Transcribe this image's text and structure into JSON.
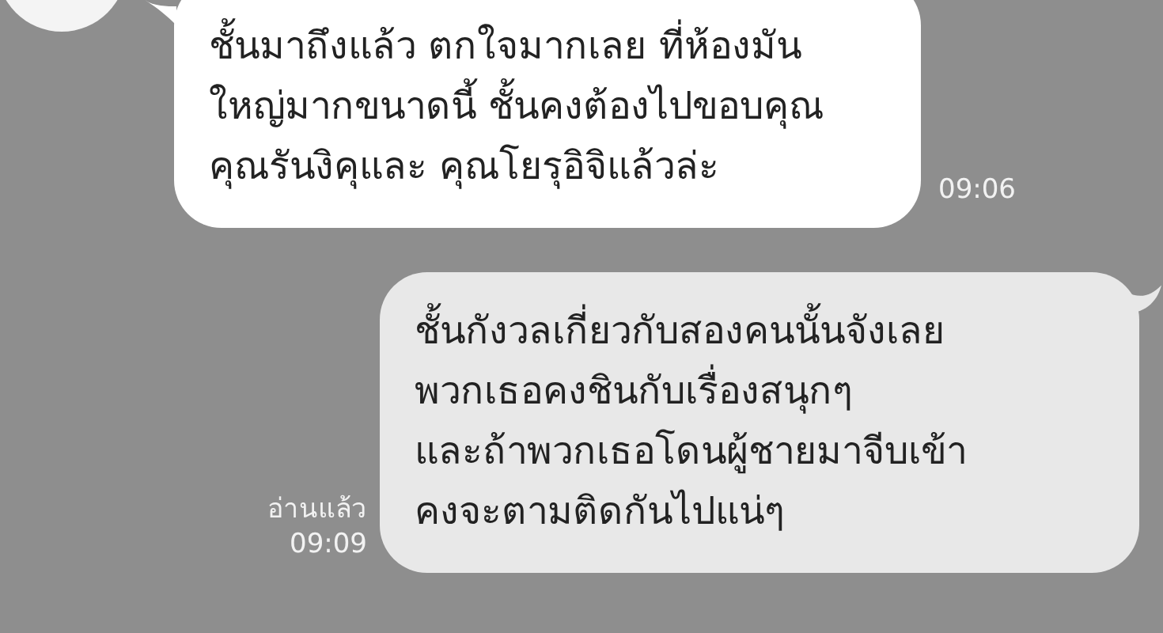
{
  "messages": [
    {
      "kind": "incoming",
      "text": "ชั้นมาถึงแล้ว ตกใจมากเลย ที่ห้องมัน\nใหญ่มากขนาดนี้ ชั้นคงต้องไปขอบคุณ\nคุณรันงิคุและ คุณโยรุอิจิแล้วล่ะ",
      "time": "09:06"
    },
    {
      "kind": "outgoing",
      "text": "ชั้นกังวลเกี่ยวกับสองคนนั้นจังเลย\nพวกเธอคงชินกับเรื่องสนุกๆ\nและถ้าพวกเธอโดนผู้ชายมาจีบเข้า\nคงจะตามติดกันไปแน่ๆ",
      "time": "09:09",
      "read_status": "อ่านแล้ว"
    }
  ]
}
